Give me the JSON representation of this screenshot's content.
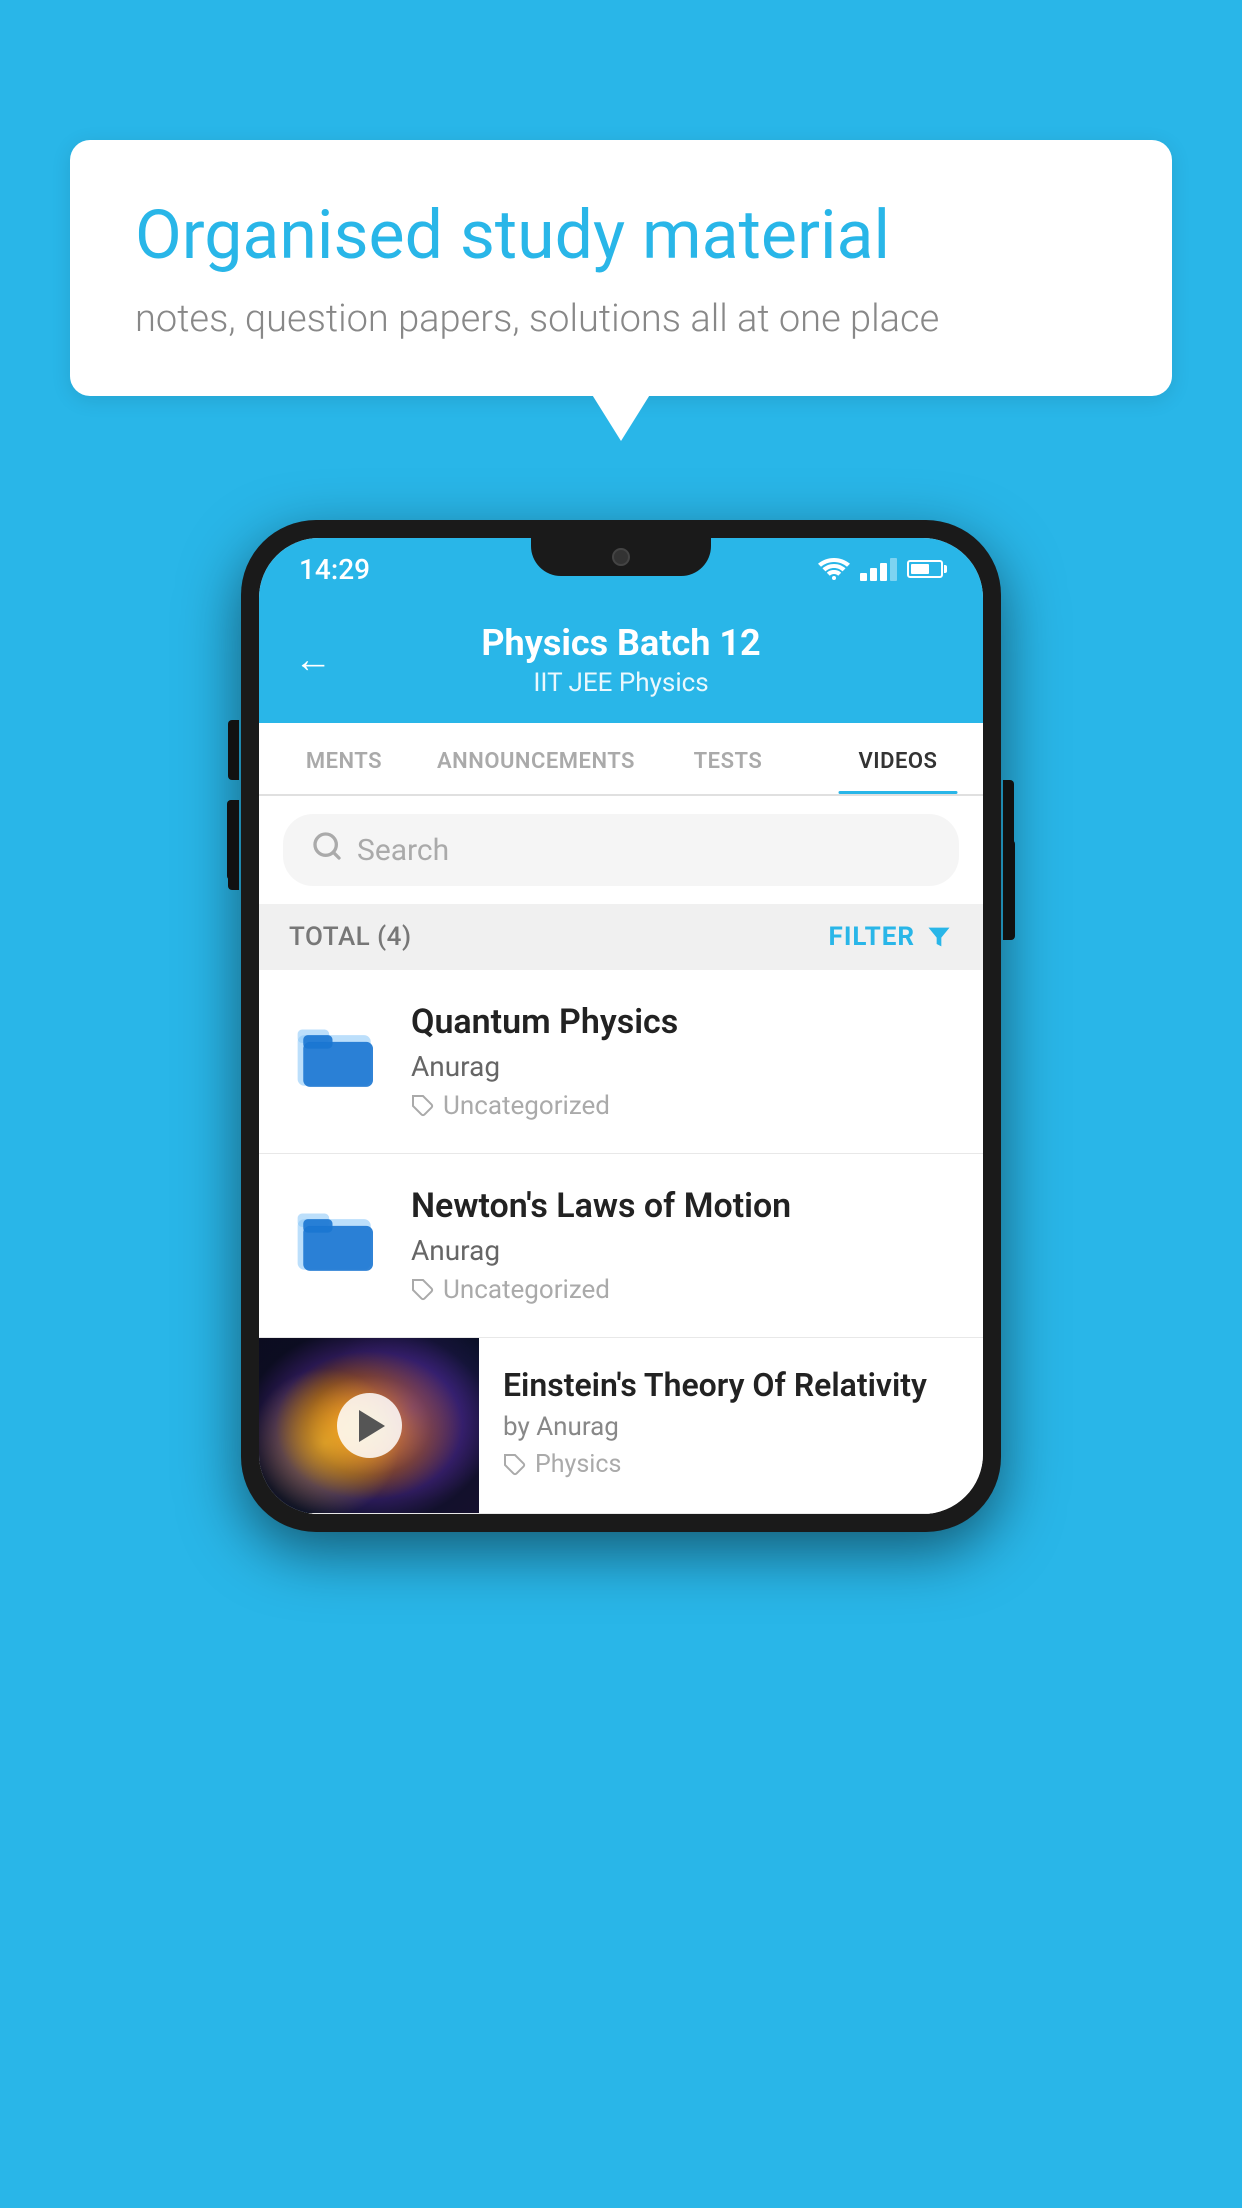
{
  "background": {
    "color": "#29b6e8"
  },
  "speech_bubble": {
    "title": "Organised study material",
    "subtitle": "notes, question papers, solutions all at one place"
  },
  "status_bar": {
    "time": "14:29"
  },
  "app_header": {
    "title": "Physics Batch 12",
    "subtitle": "IIT JEE    Physics",
    "back_label": "←"
  },
  "tabs": [
    {
      "label": "MENTS",
      "active": false
    },
    {
      "label": "ANNOUNCEMENTS",
      "active": false
    },
    {
      "label": "TESTS",
      "active": false
    },
    {
      "label": "VIDEOS",
      "active": true
    }
  ],
  "search": {
    "placeholder": "Search"
  },
  "filter_row": {
    "total_label": "TOTAL (4)",
    "filter_label": "FILTER"
  },
  "videos": [
    {
      "id": 1,
      "title": "Quantum Physics",
      "author": "Anurag",
      "tag": "Uncategorized",
      "type": "folder"
    },
    {
      "id": 2,
      "title": "Newton's Laws of Motion",
      "author": "Anurag",
      "tag": "Uncategorized",
      "type": "folder"
    },
    {
      "id": 3,
      "title": "Einstein's Theory Of Relativity",
      "author": "by Anurag",
      "tag": "Physics",
      "type": "video"
    }
  ]
}
